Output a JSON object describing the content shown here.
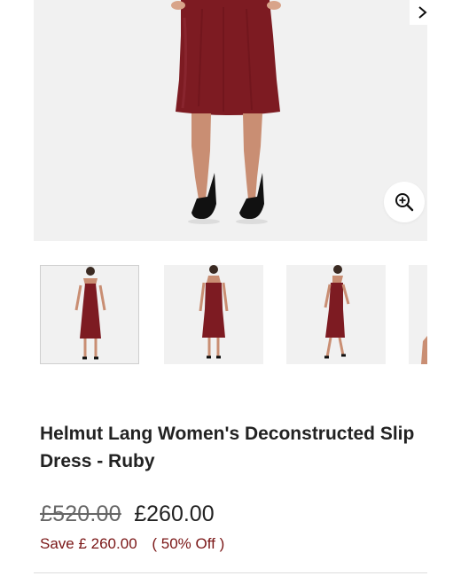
{
  "gallery": {
    "zoom_icon": "zoom-in-icon",
    "next_icon": "chevron-right-icon",
    "thumbnail_count_visible": 4,
    "dress_color": "#7d1b22"
  },
  "product": {
    "title": "Helmut Lang Women's Deconstructed Slip Dress - Ruby"
  },
  "pricing": {
    "original_price": "£520.00",
    "sale_price": "£260.00",
    "save_text": "Save £ 260.00",
    "discount_text": "( 50% Off )",
    "accent_color": "#7a1616"
  }
}
